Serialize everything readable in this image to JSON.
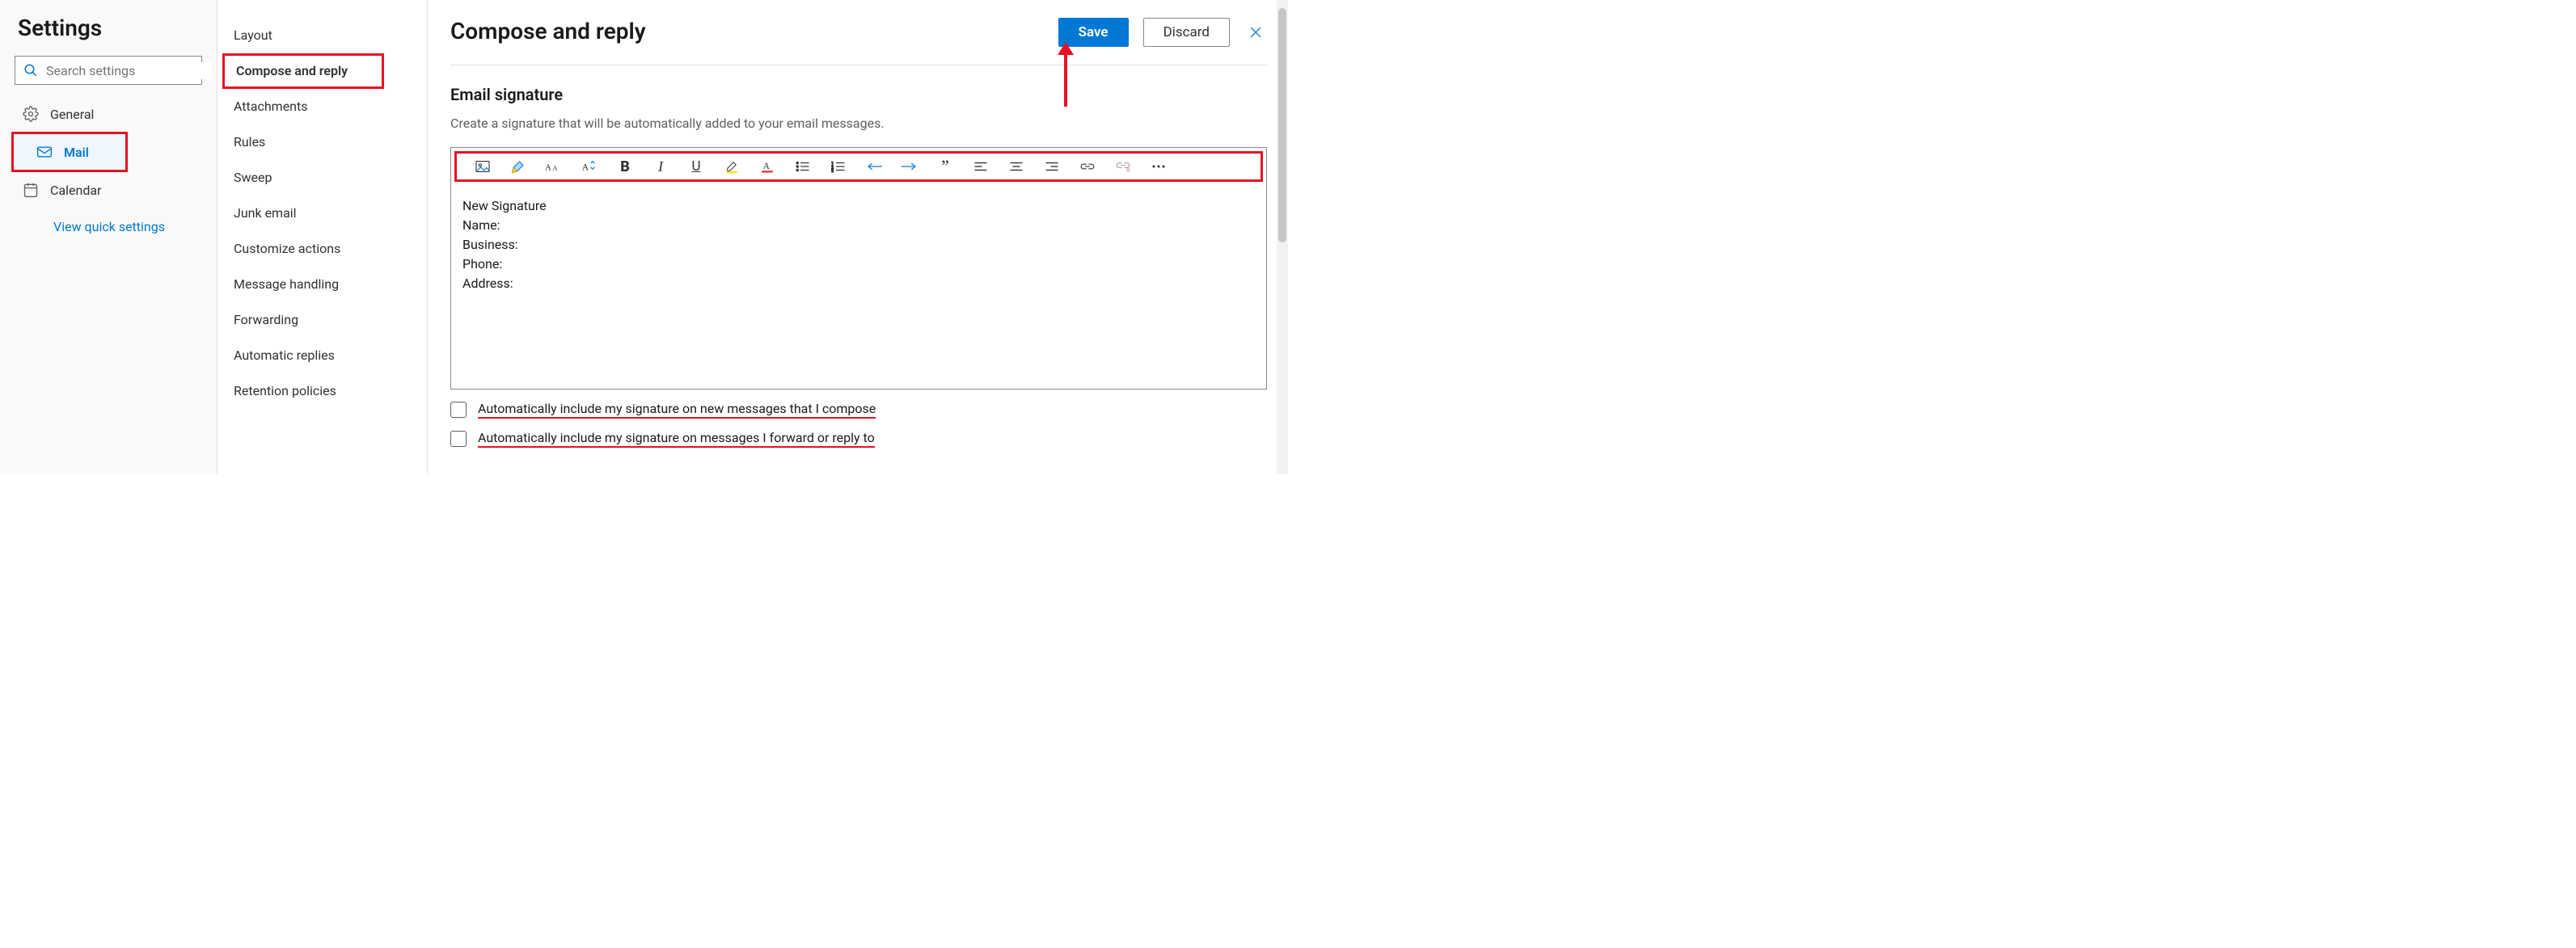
{
  "sidebar": {
    "title": "Settings",
    "search_placeholder": "Search settings",
    "categories": [
      {
        "id": "general",
        "label": "General",
        "icon": "gear-icon",
        "active": false
      },
      {
        "id": "mail",
        "label": "Mail",
        "icon": "mail-icon",
        "active": true
      },
      {
        "id": "calendar",
        "label": "Calendar",
        "icon": "calendar-icon",
        "active": false
      }
    ],
    "quick_link": "View quick settings"
  },
  "subnav": {
    "items": [
      "Layout",
      "Compose and reply",
      "Attachments",
      "Rules",
      "Sweep",
      "Junk email",
      "Customize actions",
      "Message handling",
      "Forwarding",
      "Automatic replies",
      "Retention policies"
    ],
    "active_index": 1
  },
  "header": {
    "title": "Compose and reply",
    "save_label": "Save",
    "discard_label": "Discard"
  },
  "section": {
    "title": "Email signature",
    "description": "Create a signature that will be automatically added to your email messages.",
    "signature_lines": [
      "New Signature",
      "Name:",
      "Business:",
      "Phone:",
      "Address:"
    ],
    "toolbar_buttons": [
      "insert-image-icon",
      "format-painter-icon",
      "font-family-icon",
      "font-size-icon",
      "bold-icon",
      "italic-icon",
      "underline-icon",
      "highlight-icon",
      "font-color-icon",
      "bulleted-list-icon",
      "numbered-list-icon",
      "decrease-indent-icon",
      "increase-indent-icon",
      "quote-icon",
      "align-left-icon",
      "align-center-icon",
      "align-right-icon",
      "insert-link-icon",
      "remove-link-icon",
      "more-options-icon"
    ],
    "checkbox1": "Automatically include my signature on new messages that I compose",
    "checkbox2": "Automatically include my signature on messages I forward or reply to",
    "checkbox1_checked": false,
    "checkbox2_checked": false
  },
  "annotations": {
    "arrow_color": "#e81123",
    "highlight_color": "#e81123"
  }
}
